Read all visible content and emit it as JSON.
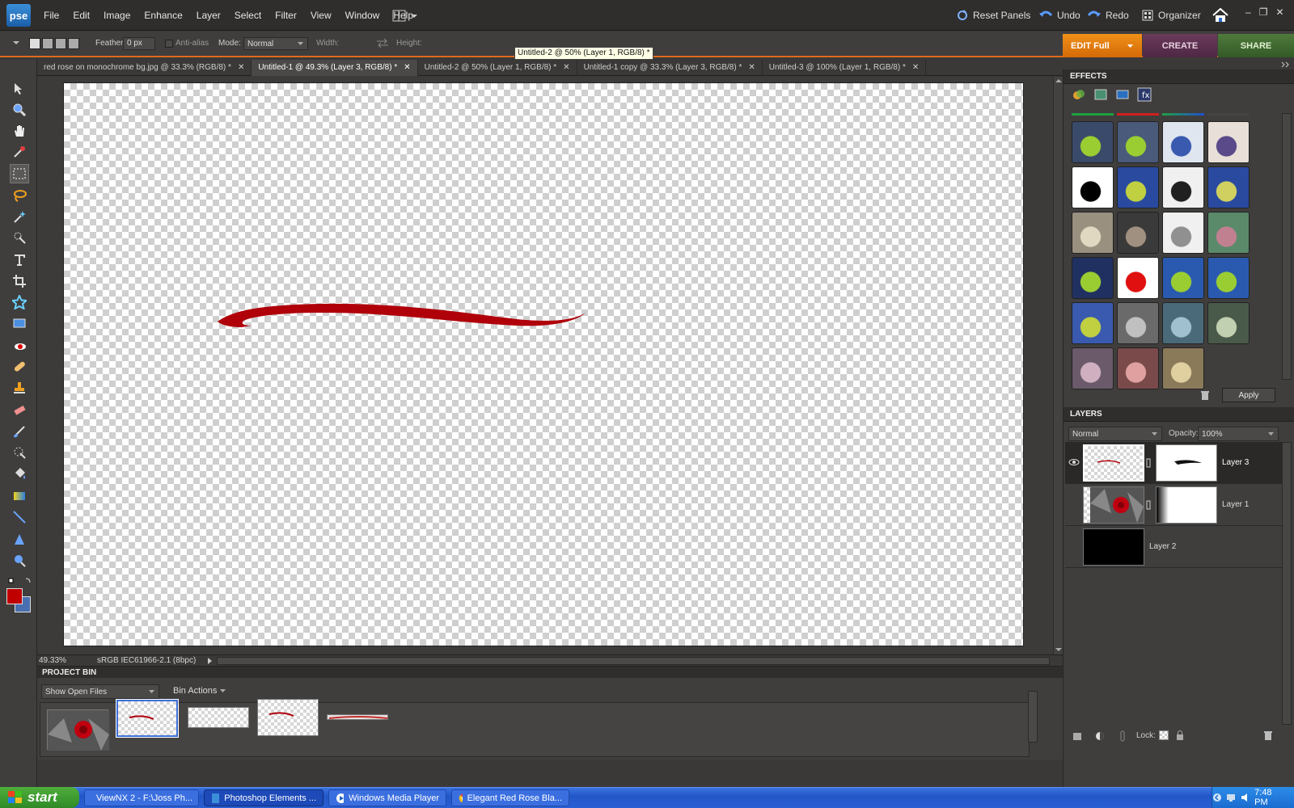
{
  "app": {
    "logo_text": "pse"
  },
  "menu": [
    "File",
    "Edit",
    "Image",
    "Enhance",
    "Layer",
    "Select",
    "Filter",
    "View",
    "Window",
    "Help"
  ],
  "toolbar_right": {
    "reset_panels": "Reset Panels",
    "undo": "Undo",
    "redo": "Redo",
    "organizer": "Organizer"
  },
  "options_bar": {
    "feather_label": "Feather:",
    "feather_value": "0 px",
    "antialias_label": "Anti-alias",
    "mode_label": "Mode:",
    "mode_value": "Normal",
    "width_label": "Width:",
    "height_label": "Height:"
  },
  "mode_tabs": {
    "edit": "EDIT Full",
    "create": "CREATE",
    "share": "SHARE"
  },
  "tooltip": "Untitled-2 @ 50% (Layer 1, RGB/8) *",
  "document_tabs": [
    {
      "label": "red rose on monochrome bg.jpg @ 33.3% (RGB/8) *",
      "active": false
    },
    {
      "label": "Untitled-1 @ 49.3% (Layer 3, RGB/8) *",
      "active": true
    },
    {
      "label": "Untitled-2 @ 50% (Layer 1, RGB/8) *",
      "active": false
    },
    {
      "label": "Untitled-1 copy @ 33.3% (Layer 3, RGB/8) *",
      "active": false
    },
    {
      "label": "Untitled-3 @ 100% (Layer 1, RGB/8) *",
      "active": false
    }
  ],
  "status": {
    "zoom": "49.33%",
    "profile": "sRGB IEC61966-2.1 (8bpc)"
  },
  "project_bin": {
    "title": "PROJECT BIN",
    "show_select": "Show Open Files",
    "bin_actions": "Bin Actions"
  },
  "effects": {
    "title": "EFFECTS",
    "apply": "Apply"
  },
  "layers": {
    "title": "LAYERS",
    "blend_mode": "Normal",
    "opacity_label": "Opacity:",
    "opacity_value": "100%",
    "lock_label": "Lock:",
    "items": [
      {
        "name": "Layer 3",
        "visible": true
      },
      {
        "name": "Layer 1",
        "visible": false
      },
      {
        "name": "Layer 2",
        "visible": false
      }
    ]
  },
  "colors": {
    "foreground": "#c00000",
    "background": "#4a6fb0",
    "accent": "#e06b1a"
  },
  "taskbar": {
    "start": "start",
    "tasks": [
      {
        "label": "ViewNX 2 - F:\\Joss Ph...",
        "active": false
      },
      {
        "label": "Photoshop Elements ...",
        "active": true
      },
      {
        "label": "Windows Media Player",
        "active": false
      },
      {
        "label": "Elegant Red Rose Bla...",
        "active": false
      }
    ],
    "clock": "7:48 PM"
  }
}
